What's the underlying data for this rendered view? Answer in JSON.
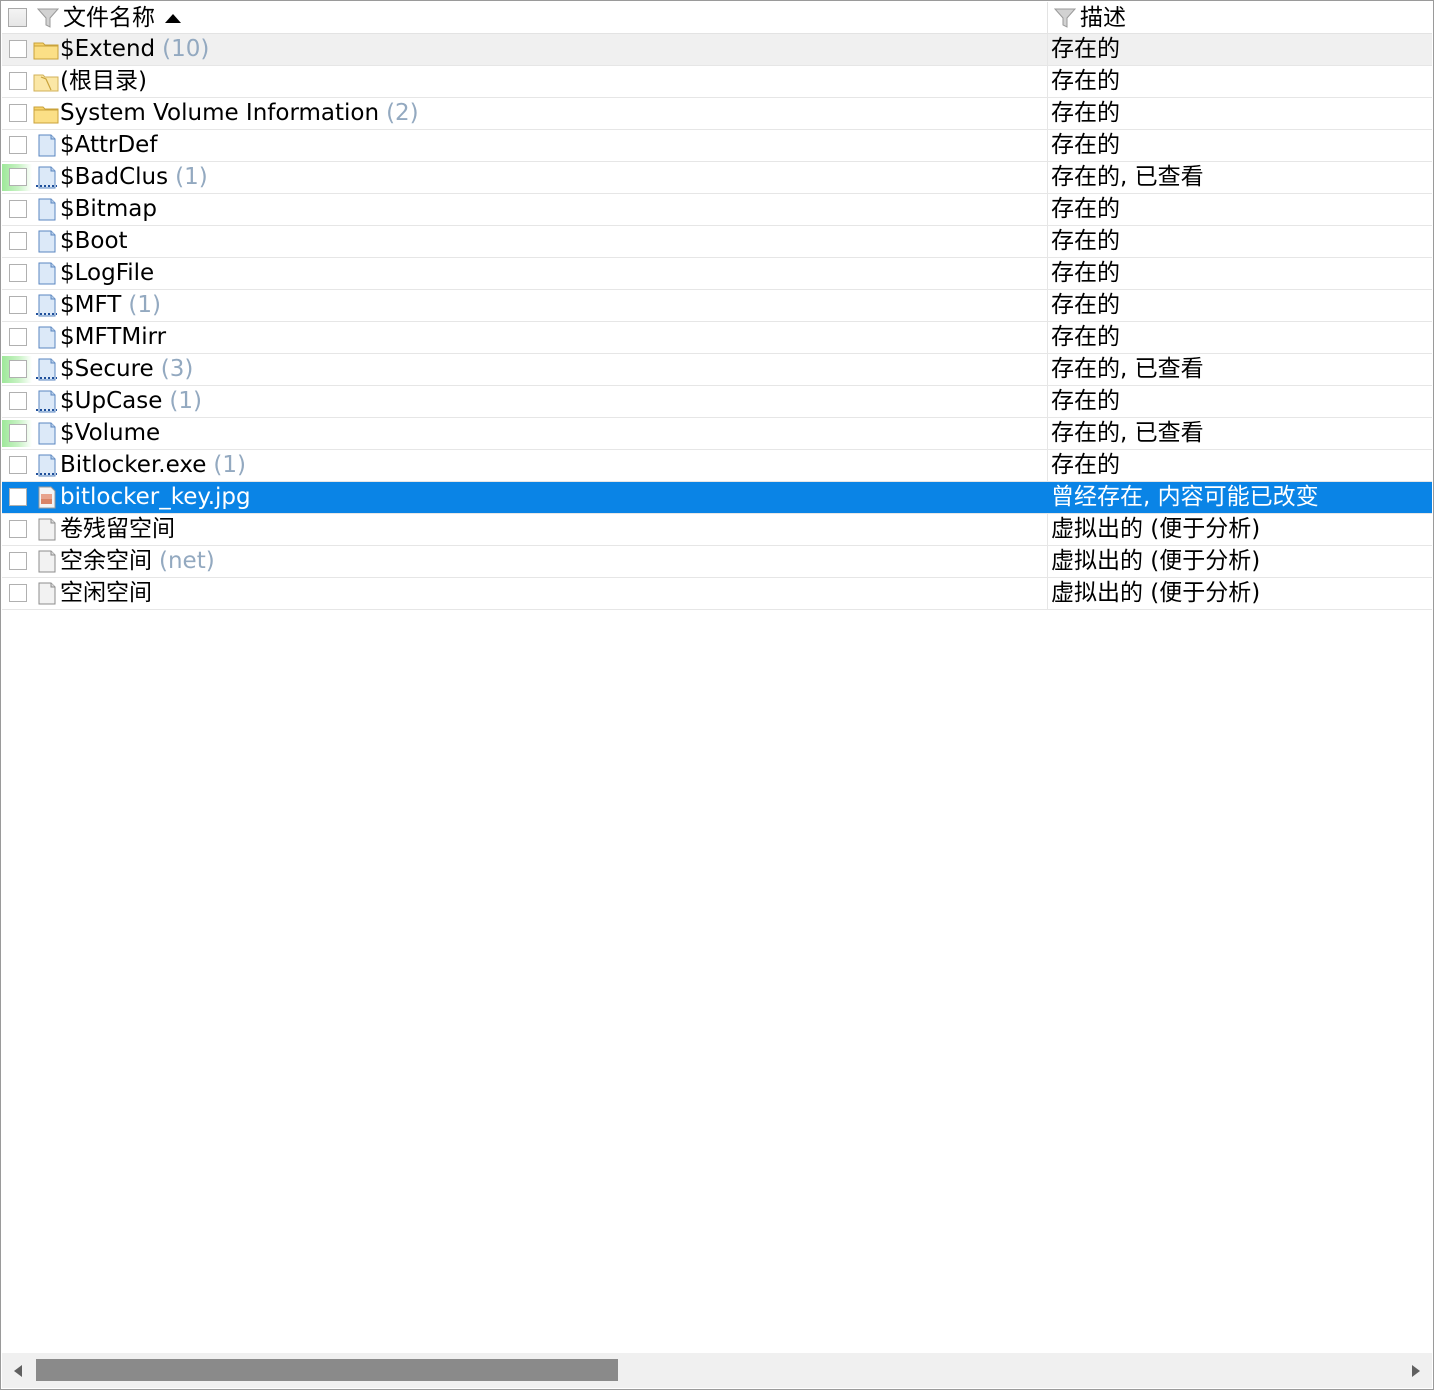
{
  "header": {
    "name_label": "文件名称",
    "desc_label": "描述"
  },
  "rows": [
    {
      "name": "$Extend",
      "count": "(10)",
      "desc": "存在的",
      "icon": "folder-icon",
      "viewed": false
    },
    {
      "name": "(根目录)",
      "count": "",
      "desc": "存在的",
      "icon": "open-folder-icon",
      "viewed": false
    },
    {
      "name": "System Volume Information",
      "count": "(2)",
      "desc": "存在的",
      "icon": "folder-icon",
      "viewed": false
    },
    {
      "name": "$AttrDef",
      "count": "",
      "desc": "存在的",
      "icon": "file-icon",
      "viewed": false
    },
    {
      "name": "$BadClus",
      "count": "(1)",
      "desc": "存在的, 已查看",
      "icon": "file-with-streams-icon",
      "viewed": true
    },
    {
      "name": "$Bitmap",
      "count": "",
      "desc": "存在的",
      "icon": "file-icon",
      "viewed": false
    },
    {
      "name": "$Boot",
      "count": "",
      "desc": "存在的",
      "icon": "file-icon",
      "viewed": false
    },
    {
      "name": "$LogFile",
      "count": "",
      "desc": "存在的",
      "icon": "file-icon",
      "viewed": false
    },
    {
      "name": "$MFT",
      "count": "(1)",
      "desc": "存在的",
      "icon": "file-with-streams-icon",
      "viewed": false
    },
    {
      "name": "$MFTMirr",
      "count": "",
      "desc": "存在的",
      "icon": "file-icon",
      "viewed": false
    },
    {
      "name": "$Secure",
      "count": "(3)",
      "desc": "存在的, 已查看",
      "icon": "file-with-streams-icon",
      "viewed": true
    },
    {
      "name": "$UpCase",
      "count": "(1)",
      "desc": "存在的",
      "icon": "file-with-streams-icon",
      "viewed": false
    },
    {
      "name": "$Volume",
      "count": "",
      "desc": "存在的, 已查看",
      "icon": "file-icon",
      "viewed": true
    },
    {
      "name": "Bitlocker.exe",
      "count": "(1)",
      "desc": "存在的",
      "icon": "file-with-streams-icon",
      "viewed": false
    },
    {
      "name": "bitlocker_key.jpg",
      "count": "",
      "desc": "曾经存在, 内容可能已改变",
      "icon": "image-file-icon",
      "viewed": false,
      "selected": true
    },
    {
      "name": "卷残留空间",
      "count": "",
      "desc": "虚拟出的 (便于分析)",
      "icon": "virtual-file-icon",
      "viewed": false
    },
    {
      "name": "空余空间",
      "count": "(net)",
      "desc": "虚拟出的 (便于分析)",
      "icon": "virtual-file-icon",
      "viewed": false
    },
    {
      "name": "空闲空间",
      "count": "",
      "desc": "虚拟出的 (便于分析)",
      "icon": "virtual-file-icon",
      "viewed": false
    }
  ],
  "colors": {
    "selection": "#0a84e6",
    "count_text": "#93a9c0",
    "viewed_mark": "#9ee89a",
    "scroll_thumb": "#8a8a8a"
  },
  "scrollbar": {
    "thumb_fraction": 0.41,
    "position_fraction": 0
  }
}
